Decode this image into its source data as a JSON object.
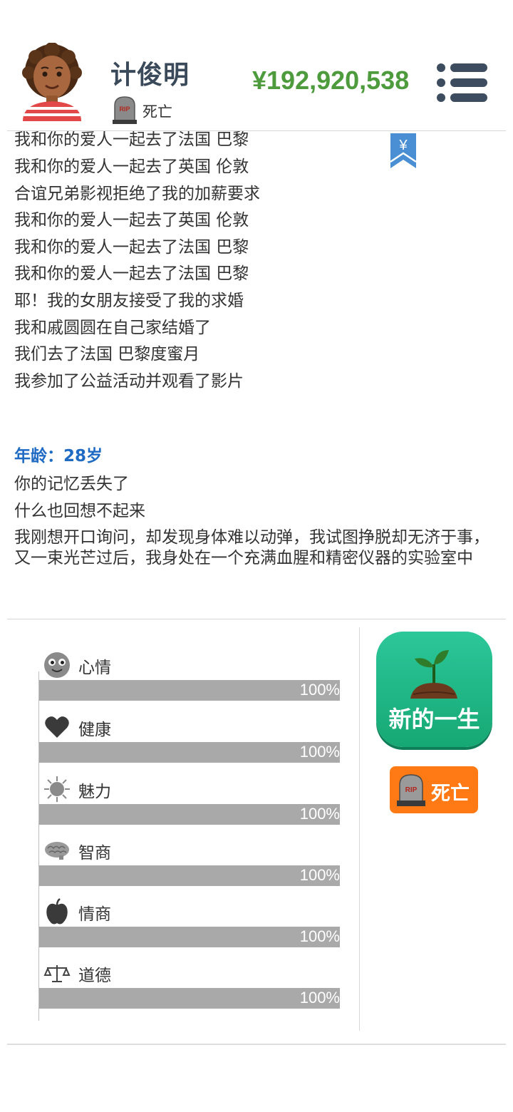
{
  "header": {
    "name": "计俊明",
    "status": "死亡",
    "money": "¥192,920,538",
    "menu_icon": "menu-icon"
  },
  "log": {
    "bookmark_symbol": "¥",
    "lines": [
      "我和你的爱人一起去了法国 巴黎",
      "我和你的爱人一起去了英国 伦敦",
      "合谊兄弟影视拒绝了我的加薪要求",
      "我和你的爱人一起去了英国 伦敦",
      "我和你的爱人一起去了法国 巴黎",
      "我和你的爱人一起去了法国 巴黎",
      "耶！我的女朋友接受了我的求婚",
      "我和戚圆圆在自己家结婚了",
      "我们去了法国 巴黎度蜜月",
      "我参加了公益活动并观看了影片"
    ],
    "age": "年龄：28岁",
    "age_lines": [
      "你的记忆丢失了",
      "什么也回想不起来"
    ],
    "paragraph": "我刚想开口询问，却发现身体难以动弹，我试图挣脱却无济于事，又一束光芒过后，我身处在一个充满血腥和精密仪器的实验室中"
  },
  "stats": [
    {
      "label": "心情",
      "value": "100%",
      "level": 1.0,
      "icon": "smiley-icon"
    },
    {
      "label": "健康",
      "value": "100%",
      "level": 1.0,
      "icon": "heart-icon"
    },
    {
      "label": "魅力",
      "value": "100%",
      "level": 1.0,
      "icon": "sun-icon"
    },
    {
      "label": "智商",
      "value": "100%",
      "level": 1.0,
      "icon": "brain-icon"
    },
    {
      "label": "情商",
      "value": "100%",
      "level": 1.0,
      "icon": "apple-icon"
    },
    {
      "label": "道德",
      "value": "100%",
      "level": 1.0,
      "icon": "scales-icon"
    }
  ],
  "actions": {
    "new_life": "新的一生",
    "death": "死亡"
  },
  "colors": {
    "money": "#4e9b3e",
    "age": "#1f6bc4",
    "new_life_bg": "#1fb985",
    "death_bg": "#ff7a14",
    "bookmark": "#4a8fd4",
    "stat_bar": "#a9a9a9"
  }
}
